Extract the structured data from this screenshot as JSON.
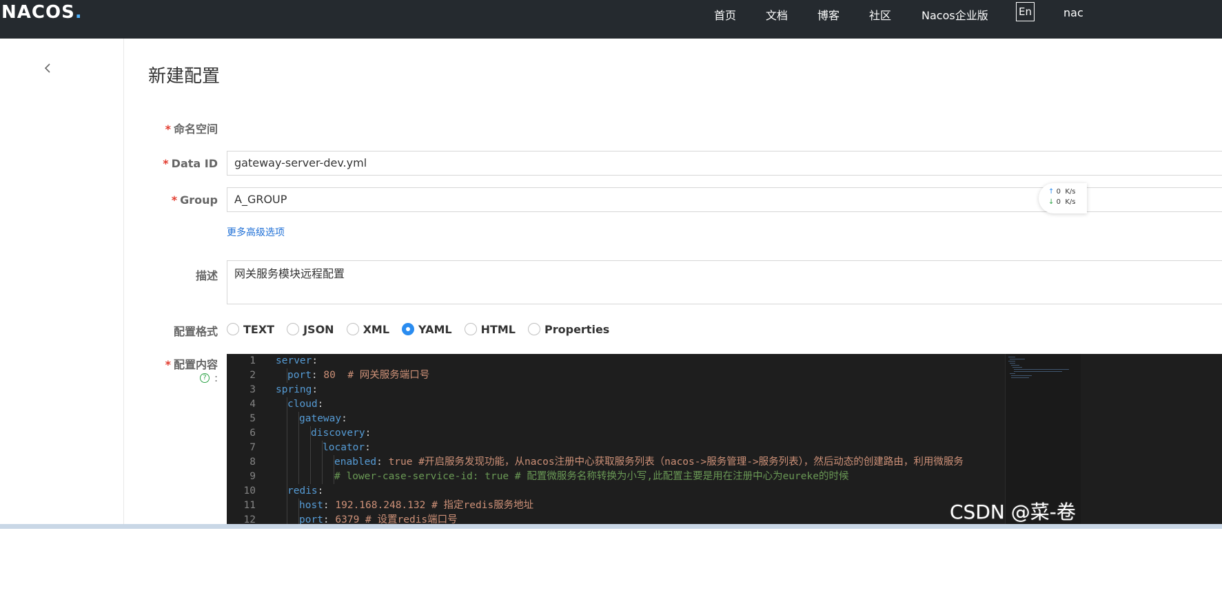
{
  "header": {
    "logo_main": "NACOS",
    "logo_dot": ".",
    "nav": [
      {
        "label": "首页"
      },
      {
        "label": "文档"
      },
      {
        "label": "博客"
      },
      {
        "label": "社区"
      },
      {
        "label": "Nacos企业版"
      }
    ],
    "lang_button": "En",
    "user_truncated": "nac"
  },
  "page": {
    "title": "新建配置"
  },
  "form": {
    "namespace_label": "命名空间",
    "data_id_label": "Data ID",
    "data_id_value": "gateway-server-dev.yml",
    "group_label": "Group",
    "group_value": "A_GROUP",
    "advanced_link": "更多高级选项",
    "description_label": "描述",
    "description_value": "网关服务模块远程配置",
    "format_label": "配置格式",
    "formats": [
      {
        "label": "TEXT",
        "checked": false
      },
      {
        "label": "JSON",
        "checked": false
      },
      {
        "label": "XML",
        "checked": false
      },
      {
        "label": "YAML",
        "checked": true
      },
      {
        "label": "HTML",
        "checked": false
      },
      {
        "label": "Properties",
        "checked": false
      }
    ],
    "content_label": "配置内容",
    "content_help_colon": ":",
    "required_mark": "*"
  },
  "editor": {
    "lines": [
      {
        "num": "1",
        "indent": 0,
        "parts": [
          [
            "k",
            "server"
          ],
          [
            "p",
            ":"
          ]
        ]
      },
      {
        "num": "2",
        "indent": 1,
        "parts": [
          [
            "k",
            "port"
          ],
          [
            "p",
            ": "
          ],
          [
            "n",
            "80"
          ],
          [
            "p",
            "  "
          ],
          [
            "c",
            "# 网关服务端口号"
          ]
        ]
      },
      {
        "num": "3",
        "indent": 0,
        "parts": [
          [
            "k",
            "spring"
          ],
          [
            "p",
            ":"
          ]
        ]
      },
      {
        "num": "4",
        "indent": 1,
        "parts": [
          [
            "k",
            "cloud"
          ],
          [
            "p",
            ":"
          ]
        ]
      },
      {
        "num": "5",
        "indent": 2,
        "parts": [
          [
            "k",
            "gateway"
          ],
          [
            "p",
            ":"
          ]
        ]
      },
      {
        "num": "6",
        "indent": 3,
        "parts": [
          [
            "k",
            "discovery"
          ],
          [
            "p",
            ":"
          ]
        ]
      },
      {
        "num": "7",
        "indent": 4,
        "parts": [
          [
            "k",
            "locator"
          ],
          [
            "p",
            ":"
          ]
        ]
      },
      {
        "num": "8",
        "indent": 5,
        "parts": [
          [
            "k",
            "enabled"
          ],
          [
            "p",
            ": "
          ],
          [
            "n",
            "true"
          ],
          [
            "p",
            " "
          ],
          [
            "c",
            "#开启服务发现功能，从nacos注册中心获取服务列表（nacos->服务管理->服务列表），然后动态的创建路由，利用微服务"
          ]
        ]
      },
      {
        "num": "9",
        "indent": 5,
        "parts": [
          [
            "cm",
            "# lower-case-service-id: true # 配置微服务名称转换为小写,此配置主要是用在注册中心为eureke的时候"
          ]
        ]
      },
      {
        "num": "10",
        "indent": 1,
        "parts": [
          [
            "k",
            "redis"
          ],
          [
            "p",
            ":"
          ]
        ]
      },
      {
        "num": "11",
        "indent": 2,
        "parts": [
          [
            "k",
            "host"
          ],
          [
            "p",
            ": "
          ],
          [
            "n",
            "192.168.248.132"
          ],
          [
            "p",
            " "
          ],
          [
            "c",
            "# 指定redis服务地址"
          ]
        ]
      },
      {
        "num": "12",
        "indent": 2,
        "parts": [
          [
            "k",
            "port"
          ],
          [
            "p",
            ": "
          ],
          [
            "n",
            "6379"
          ],
          [
            "p",
            " "
          ],
          [
            "c",
            "# 设置redis端口号"
          ]
        ]
      }
    ]
  },
  "speed_widget": {
    "up_arrow": "↑",
    "up_value": "0",
    "down_arrow": "↓",
    "down_value": "0",
    "unit": "K/s"
  },
  "watermark": "CSDN @菜-卷"
}
